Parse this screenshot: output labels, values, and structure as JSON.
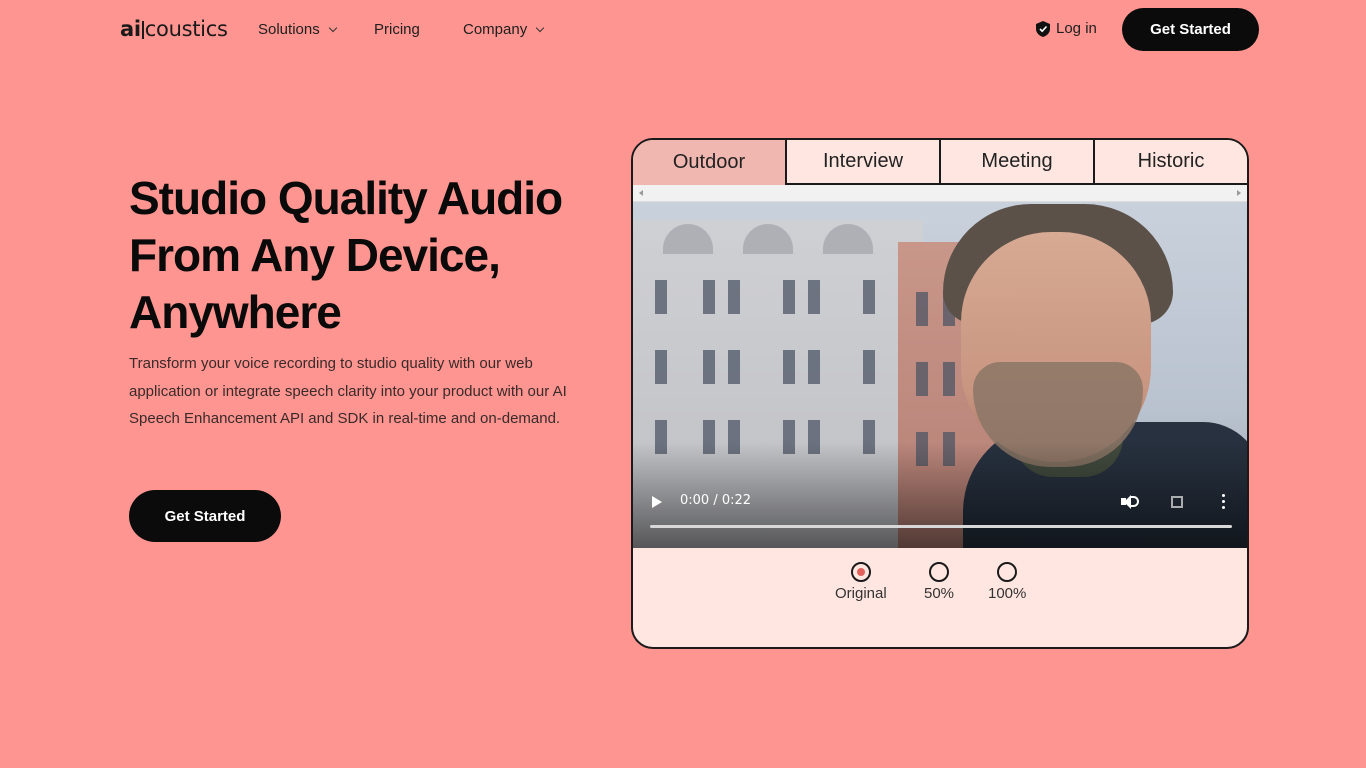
{
  "brand": {
    "logo_ai": "ai",
    "logo_rest": "coustics"
  },
  "nav": {
    "items": [
      {
        "label": "Solutions",
        "has_dropdown": true
      },
      {
        "label": "Pricing",
        "has_dropdown": false
      },
      {
        "label": "Company",
        "has_dropdown": true
      }
    ],
    "login_label": "Log in",
    "cta_label": "Get Started"
  },
  "hero": {
    "title_line1": "Studio Quality Audio",
    "title_line2": "From Any Device,",
    "title_line3": "Anywhere",
    "description": "Transform your voice recording to studio quality with our web application or integrate speech clarity into your product with our AI Speech Enhancement API and SDK in real-time and on-demand.",
    "cta_label": "Get Started"
  },
  "demo": {
    "tabs": [
      {
        "label": "Outdoor",
        "active": true
      },
      {
        "label": "Interview",
        "active": false
      },
      {
        "label": "Meeting",
        "active": false
      },
      {
        "label": "Historic",
        "active": false
      }
    ],
    "video": {
      "time": "0:00 / 0:22",
      "progress": 0
    },
    "options": [
      {
        "label": "Original",
        "selected": true
      },
      {
        "label": "50%",
        "selected": false
      },
      {
        "label": "100%",
        "selected": false
      }
    ]
  },
  "colors": {
    "background": "#ff9590",
    "card": "#ffe6e0",
    "active_tab": "#f0b7b0",
    "radio_selected": "#e0625b",
    "button": "#0b0b0b"
  },
  "icons": [
    "shield-icon",
    "chevron-down-icon",
    "play-icon",
    "volume-icon",
    "fullscreen-icon",
    "more-vertical-icon"
  ]
}
